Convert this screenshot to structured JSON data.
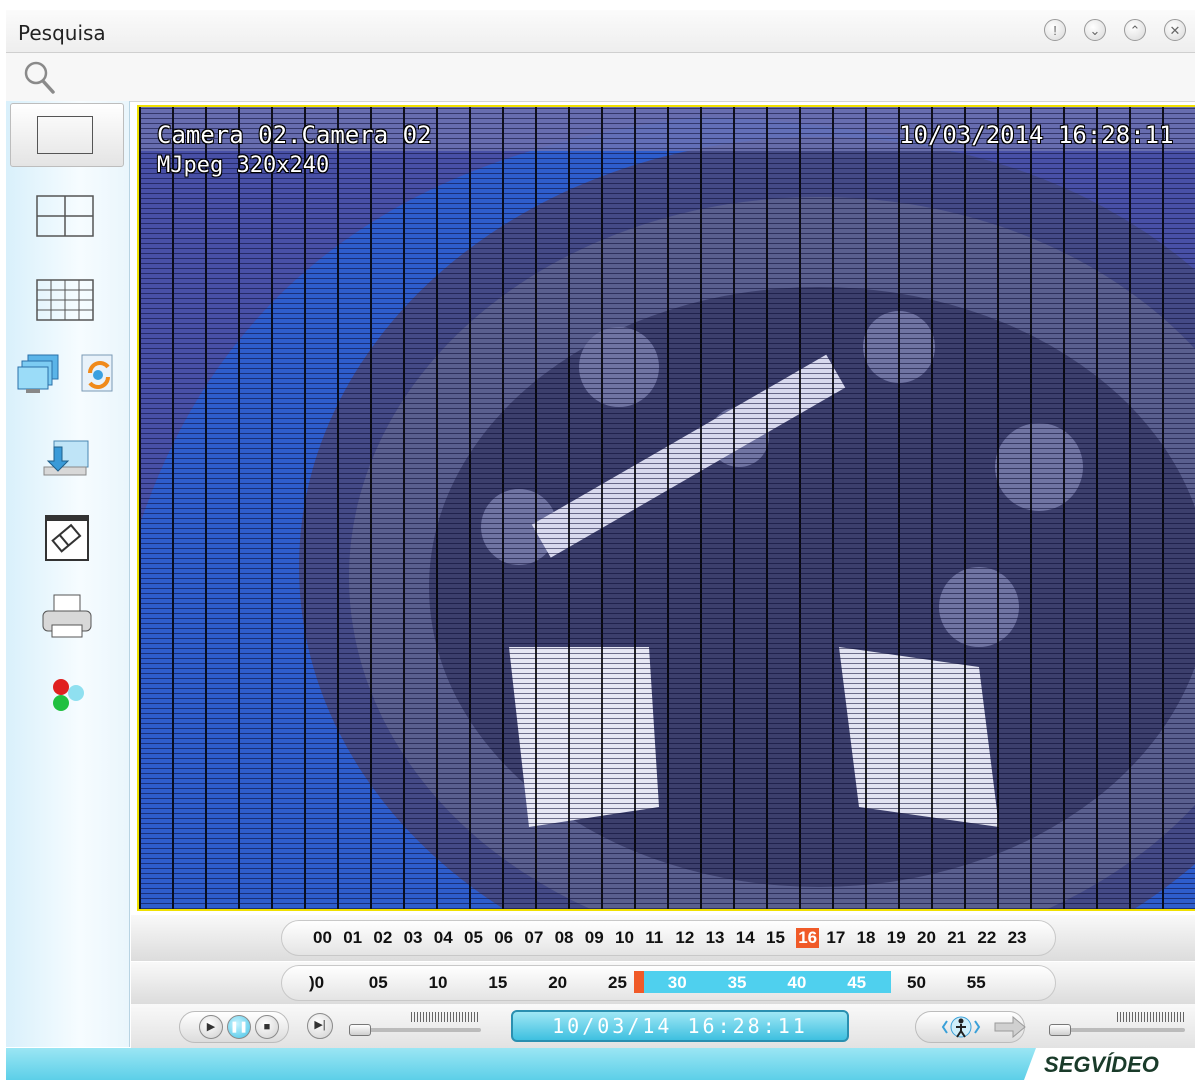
{
  "window": {
    "title": "Pesquisa",
    "buttons": [
      "info-icon",
      "minimize-icon",
      "maximize-icon",
      "close-icon"
    ]
  },
  "toolbar": {
    "icon": "search-icon"
  },
  "sidebar": {
    "items": [
      {
        "name": "single-view-icon"
      },
      {
        "name": "quad-view-icon"
      },
      {
        "name": "grid-view-icon"
      },
      {
        "name": "monitors-icon"
      },
      {
        "name": "refresh-icon"
      },
      {
        "name": "export-icon"
      },
      {
        "name": "snapshot-icon"
      },
      {
        "name": "print-icon"
      },
      {
        "name": "color-adjust-icon"
      }
    ]
  },
  "video": {
    "camera_label": "Camera 02.Camera 02",
    "timestamp": "10/03/2014 16:28:11",
    "codec": "MJpeg 320x240"
  },
  "timeline": {
    "hours": [
      "00",
      "01",
      "02",
      "03",
      "04",
      "05",
      "06",
      "07",
      "08",
      "09",
      "10",
      "11",
      "12",
      "13",
      "14",
      "15",
      "16",
      "17",
      "18",
      "19",
      "20",
      "21",
      "22",
      "23"
    ],
    "selected_hour": "16",
    "minutes": [
      ")0",
      "05",
      "10",
      "15",
      "20",
      "25",
      "30",
      "35",
      "40",
      "45",
      "50",
      "55"
    ],
    "highlight_start": 6,
    "highlight_end": 10
  },
  "controls": {
    "datetime": "10/03/14 16:28:11"
  },
  "brand": {
    "text": "SEGVÍDEO"
  },
  "colors": {
    "accent": "#4fc9e6",
    "selected": "#f05a28",
    "frame": "#f0e000"
  }
}
